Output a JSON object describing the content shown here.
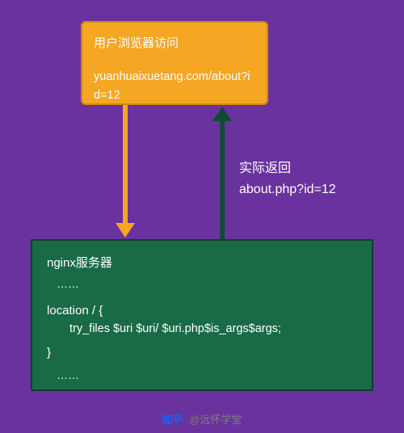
{
  "browser": {
    "title": "用户浏览器访问",
    "url": "yuanhuaixuetang.com/about?id=12"
  },
  "response": {
    "label_line1": "实际返回",
    "label_line2": "about.php?id=12"
  },
  "server": {
    "title": "nginx服务器",
    "dots1": "……",
    "location_open": "location / {",
    "try_files": "try_files $uri  $uri/  $uri.php$is_args$args;",
    "location_close": "}",
    "dots2": "……"
  },
  "footer": {
    "brand": "知乎",
    "author": "@远怀学堂"
  },
  "colors": {
    "bg": "#6a329f",
    "orange": "#f5a623",
    "green": "#196b47",
    "dark_green": "#0e4d33"
  }
}
